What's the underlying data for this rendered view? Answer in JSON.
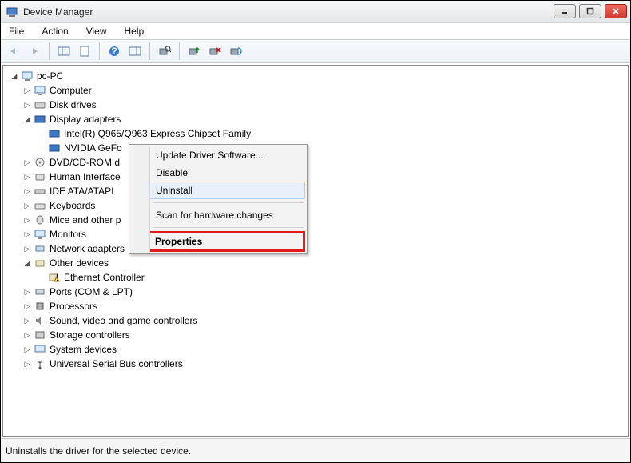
{
  "window": {
    "title": "Device Manager"
  },
  "menu": {
    "file": "File",
    "action": "Action",
    "view": "View",
    "help": "Help"
  },
  "tree": {
    "root": "pc-PC",
    "computer": "Computer",
    "diskdrives": "Disk drives",
    "displayadapters": "Display adapters",
    "da_intel": "Intel(R)  Q965/Q963 Express Chipset Family",
    "da_nvidia": "NVIDIA GeFo",
    "dvd": "DVD/CD-ROM d",
    "hid": "Human Interface",
    "idea": "IDE ATA/ATAPI",
    "keyboards": "Keyboards",
    "mice": "Mice and other p",
    "monitors": "Monitors",
    "netadapters": "Network adapters",
    "otherdev": "Other devices",
    "ethctrl": "Ethernet Controller",
    "ports": "Ports (COM & LPT)",
    "processors": "Processors",
    "sound": "Sound, video and game controllers",
    "storage": "Storage controllers",
    "sysdev": "System devices",
    "usb": "Universal Serial Bus controllers"
  },
  "context": {
    "update": "Update Driver Software...",
    "disable": "Disable",
    "uninstall": "Uninstall",
    "scan": "Scan for hardware changes",
    "properties": "Properties"
  },
  "status": {
    "text": "Uninstalls the driver for the selected device."
  }
}
